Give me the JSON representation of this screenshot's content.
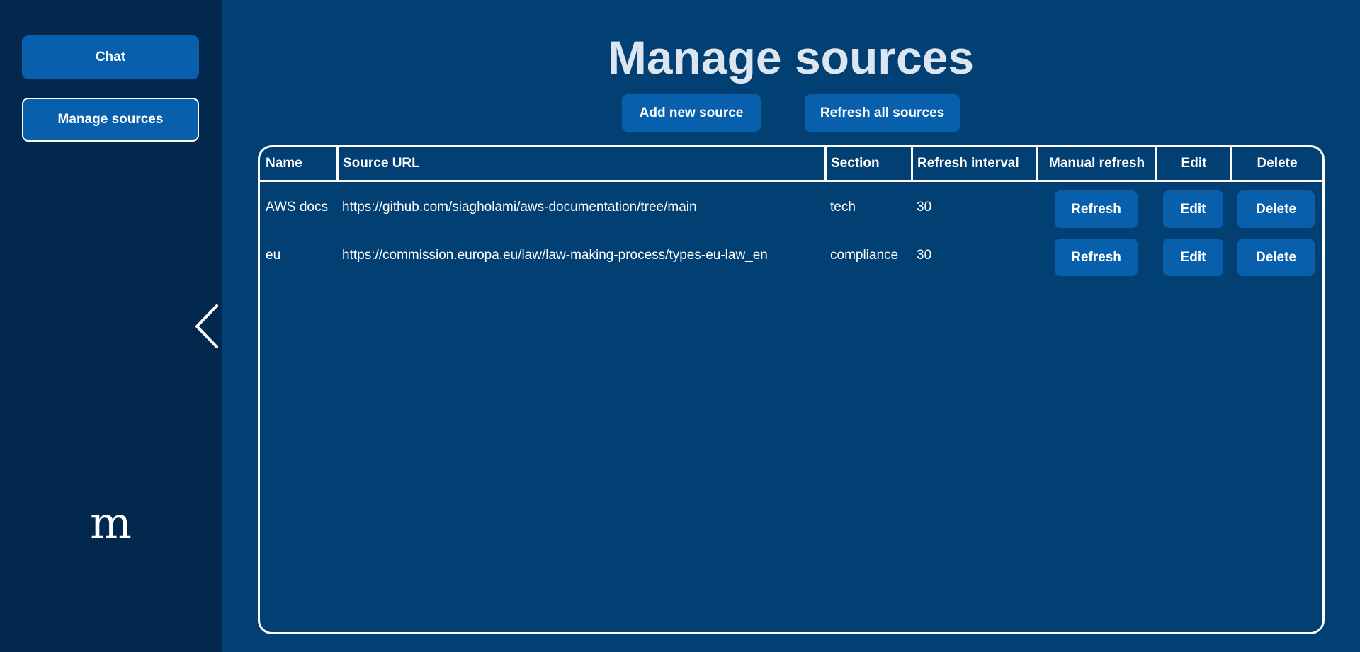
{
  "sidebar": {
    "chat_label": "Chat",
    "manage_label": "Manage sources",
    "logo_text": "m"
  },
  "header": {
    "title": "Manage sources",
    "add_label": "Add new source",
    "refresh_all_label": "Refresh all sources"
  },
  "table": {
    "columns": [
      "Name",
      "Source URL",
      "Section",
      "Refresh interval",
      "Manual refresh",
      "Edit",
      "Delete"
    ],
    "rows": [
      {
        "name": "AWS docs",
        "url": "https://github.com/siagholami/aws-documentation/tree/main",
        "section": "tech",
        "interval": "30",
        "refresh_label": "Refresh",
        "edit_label": "Edit",
        "delete_label": "Delete"
      },
      {
        "name": "eu",
        "url": "https://commission.europa.eu/law/law-making-process/types-eu-law_en",
        "section": "compliance",
        "interval": "30",
        "refresh_label": "Refresh",
        "edit_label": "Edit",
        "delete_label": "Delete"
      }
    ]
  },
  "icons": {
    "collapse": "chevron-left-icon"
  },
  "colors": {
    "background": "#023f72",
    "sidebar": "#03284d",
    "button": "#0860ad",
    "title": "#dce6f0"
  }
}
